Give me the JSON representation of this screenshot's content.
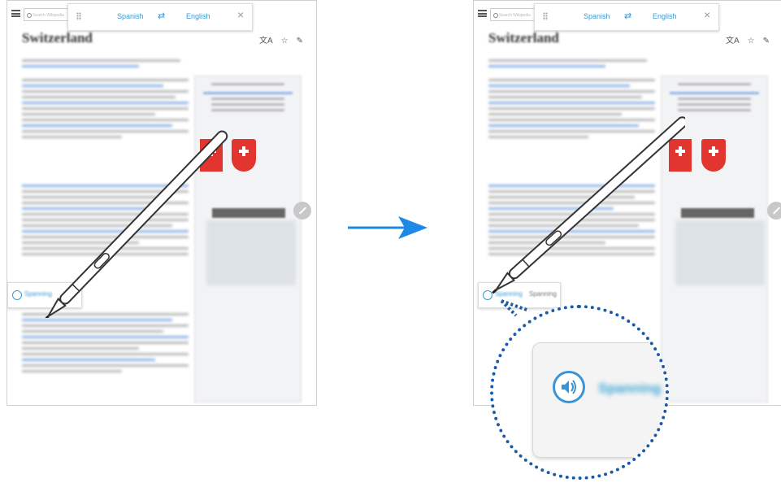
{
  "translator": {
    "source_lang": "Spanish",
    "swap_glyph": "⇄",
    "target_lang": "English",
    "close_glyph": "×"
  },
  "article": {
    "title": "Switzerland",
    "search_placeholder": "Search Wikipedia",
    "icons": [
      "translate-icon",
      "star-icon",
      "edit-icon"
    ]
  },
  "tooltip": {
    "original_word": "Spanning",
    "translated_word": "Spanning"
  },
  "colors": {
    "accent": "#3a9bd3",
    "magnifier_border": "#1a5aa8",
    "flag_red": "#e3352f",
    "arrow": "#1e88e5"
  }
}
